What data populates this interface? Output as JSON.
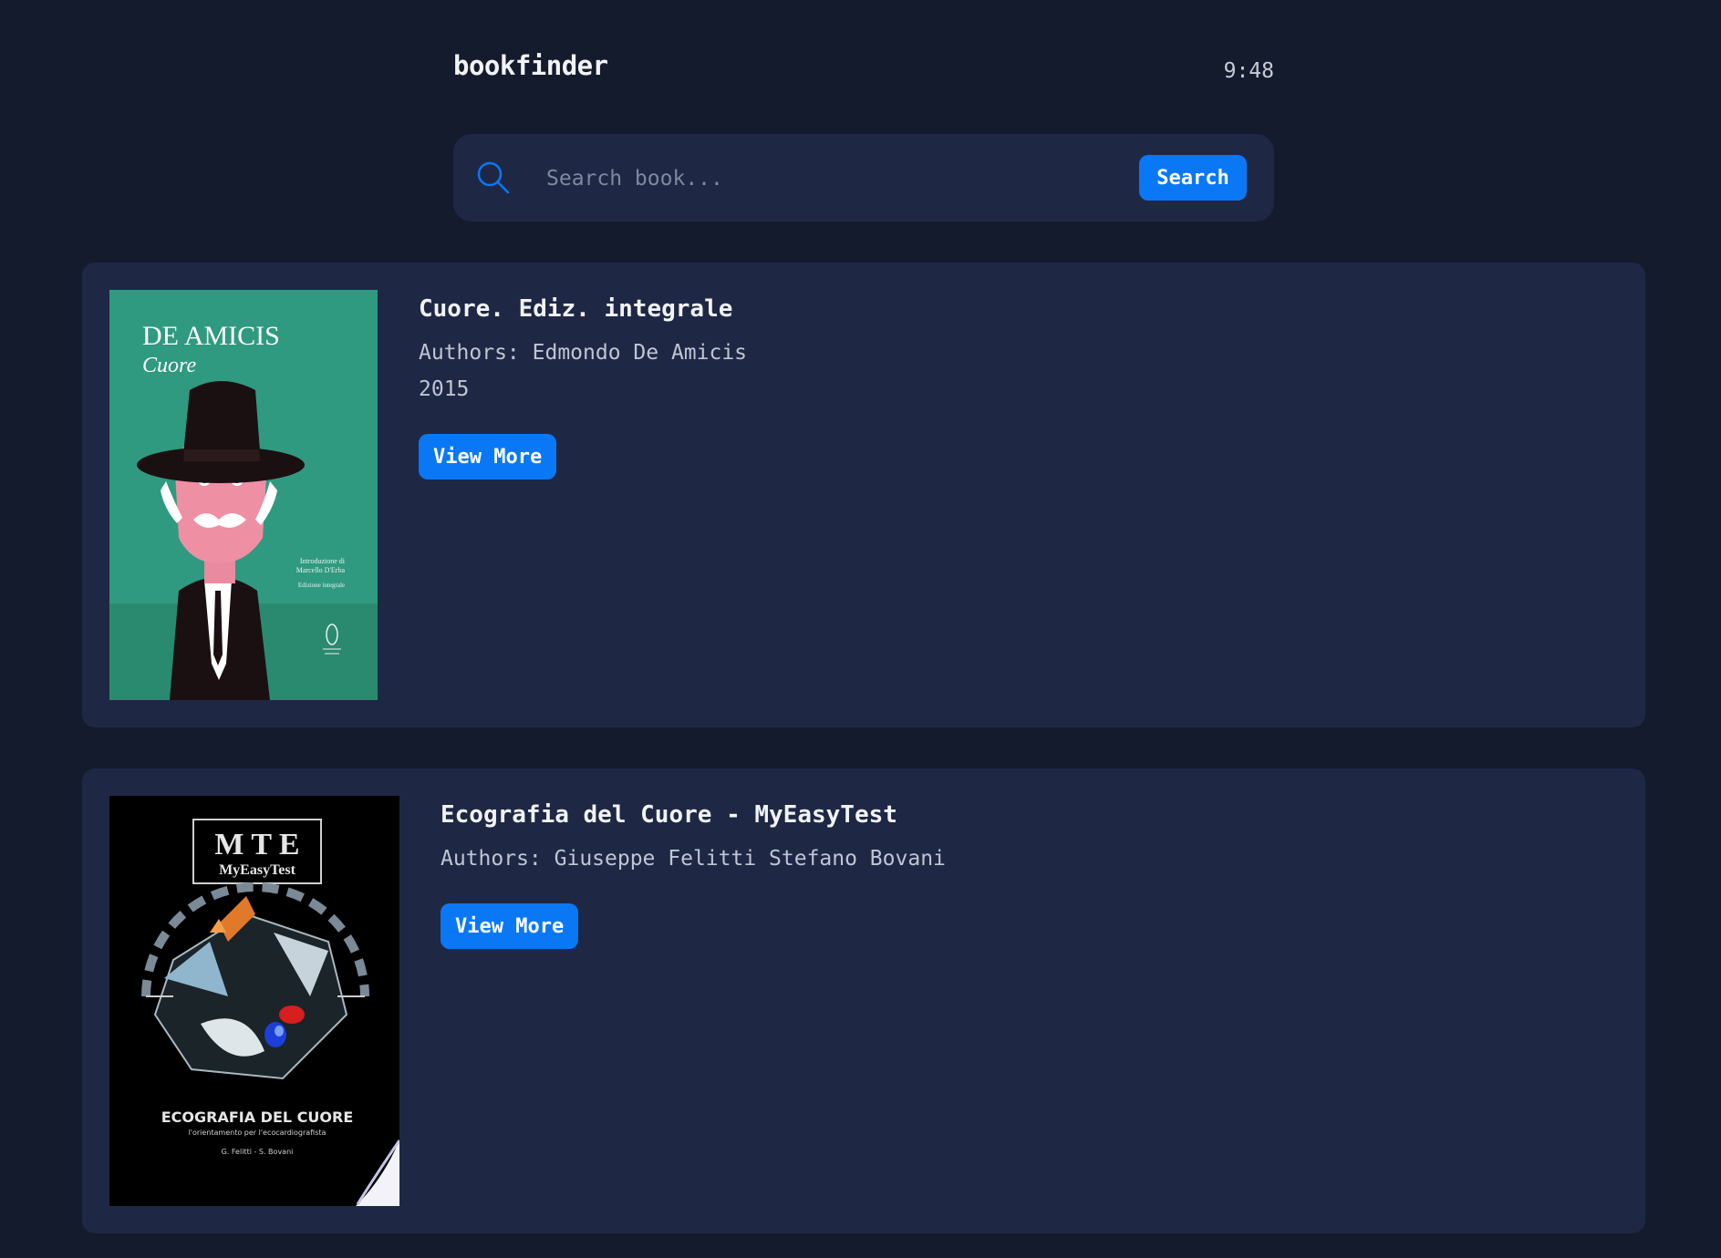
{
  "header": {
    "app_title": "bookfinder",
    "time": "9:48"
  },
  "search": {
    "placeholder": "Search book...",
    "value": "",
    "button_label": "Search",
    "icon": "search-icon"
  },
  "results": [
    {
      "title": "Cuore. Ediz. integrale",
      "authors": "Authors: Edmondo De Amicis",
      "year": "2015",
      "button_label": "View More",
      "cover": {
        "author_text": "DE AMICIS",
        "title_text": "Cuore",
        "intro_line1": "Introduzione di",
        "intro_line2": "Marcello D'Erba",
        "edition_text": "Edizione integrale",
        "color": "#2f9a7f"
      }
    },
    {
      "title": "Ecografia del Cuore - MyEasyTest",
      "authors": "Authors: Giuseppe Felitti Stefano Bovani",
      "year": "",
      "button_label": "View More",
      "cover": {
        "logo_text": "M T E",
        "logo_subtext": "MyEasyTest",
        "title_text": "ECOGRAFIA DEL CUORE",
        "subtitle_text": "l'orientamento per l'ecocardiografista",
        "authors_text": "G. Felitti - S. Bovani",
        "color": "#000000"
      }
    }
  ],
  "colors": {
    "background": "#141b2d",
    "card": "#1e2845",
    "accent": "#0a78f5"
  }
}
